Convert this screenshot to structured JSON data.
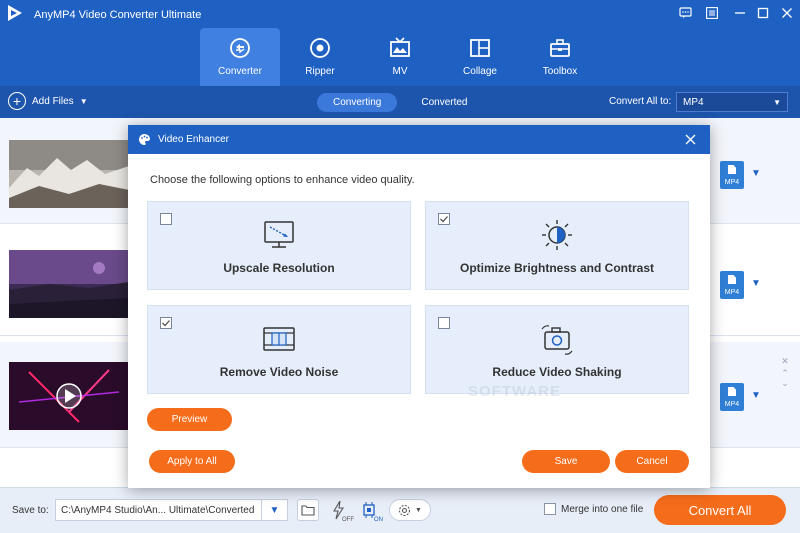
{
  "app": {
    "title": "AnyMP4 Video Converter Ultimate"
  },
  "nav": {
    "tabs": [
      {
        "label": "Converter",
        "icon": "converter-icon",
        "active": true
      },
      {
        "label": "Ripper",
        "icon": "ripper-icon",
        "active": false
      },
      {
        "label": "MV",
        "icon": "mv-icon",
        "active": false
      },
      {
        "label": "Collage",
        "icon": "collage-icon",
        "active": false
      },
      {
        "label": "Toolbox",
        "icon": "toolbox-icon",
        "active": false
      }
    ]
  },
  "toolbar": {
    "add_files": "Add Files",
    "tab_converting": "Converting",
    "tab_converted": "Converted",
    "convert_all_to_label": "Convert All to:",
    "format": "MP4"
  },
  "files": {
    "format_badge": "MP4"
  },
  "dialog": {
    "title": "Video Enhancer",
    "description": "Choose the following options to enhance video quality.",
    "options": [
      {
        "label": "Upscale Resolution",
        "checked": false
      },
      {
        "label": "Optimize Brightness and Contrast",
        "checked": true
      },
      {
        "label": "Remove Video Noise",
        "checked": true
      },
      {
        "label": "Reduce Video Shaking",
        "checked": false
      }
    ],
    "watermark": "SOFTWARE",
    "preview": "Preview",
    "apply_to_all": "Apply to All",
    "save": "Save",
    "cancel": "Cancel"
  },
  "bottom": {
    "save_to_label": "Save to:",
    "path": "C:\\AnyMP4 Studio\\An... Ultimate\\Converted",
    "merge_label": "Merge into one file",
    "convert_all": "Convert All",
    "hw_off": "OFF",
    "hw_on": "ON"
  },
  "colors": {
    "brand_blue": "#1f61c2",
    "accent_orange": "#f56c1a"
  }
}
